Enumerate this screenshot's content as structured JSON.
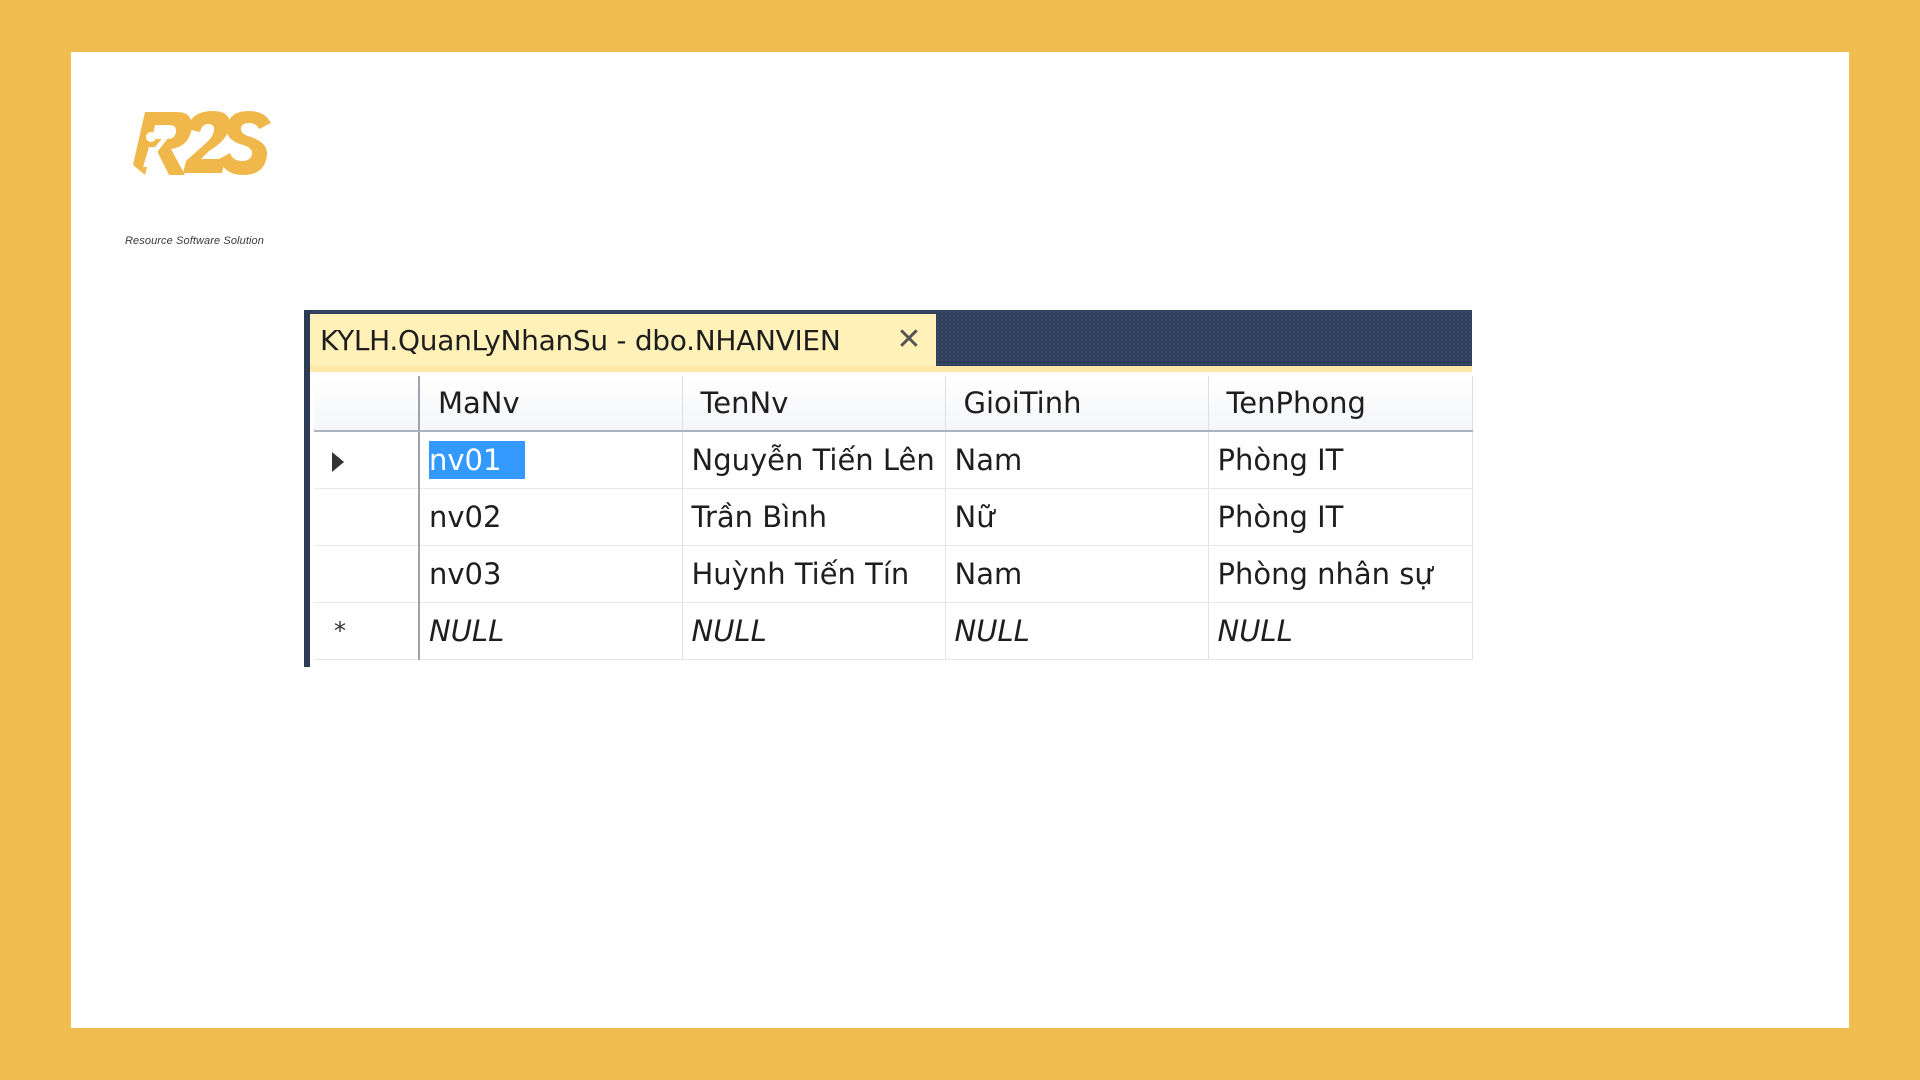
{
  "brand": {
    "logo_text": "R2S",
    "tagline": "Resource Software Solution"
  },
  "window": {
    "tab_title": "KYLH.QuanLyNhanSu - dbo.NHANVIEN",
    "close_glyph": "✕"
  },
  "grid": {
    "columns": [
      "MaNv",
      "TenNv",
      "GioiTinh",
      "TenPhong"
    ],
    "rows": [
      [
        "nv01",
        "Nguyễn Tiến Lên",
        "Nam",
        "Phòng IT"
      ],
      [
        "nv02",
        "Trần Bình",
        "Nữ",
        "Phòng IT"
      ],
      [
        "nv03",
        "Huỳnh Tiến Tín",
        "Nam",
        "Phòng nhân sự"
      ],
      [
        "NULL",
        "NULL",
        "NULL",
        "NULL"
      ]
    ],
    "row_markers": [
      "current-row-arrow-icon",
      "",
      "",
      "new-row-star-icon"
    ],
    "selected_cell": "nv01"
  },
  "colors": {
    "background": "#F2BD50",
    "card": "#FFFFFF",
    "tab_active": "#FFF1B8",
    "tabstrip": "#2F3E5A",
    "selection": "#3399FF",
    "logo": "#F0B84A"
  }
}
